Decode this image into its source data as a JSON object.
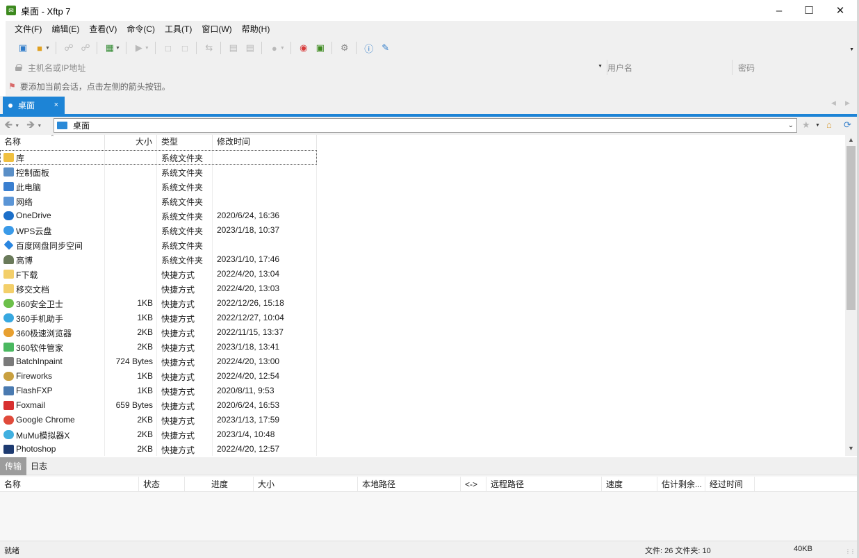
{
  "window": {
    "title": "桌面 - Xftp 7",
    "app_icon": "xftp-icon"
  },
  "menu": [
    "文件(F)",
    "编辑(E)",
    "查看(V)",
    "命令(C)",
    "工具(T)",
    "窗口(W)",
    "帮助(H)"
  ],
  "address": {
    "host_placeholder": "主机名或IP地址",
    "user_placeholder": "用户名",
    "password_placeholder": "密码"
  },
  "hint": "要添加当前会话，点击左侧的箭头按钮。",
  "tab": {
    "label": "桌面",
    "close": "×"
  },
  "path": "桌面",
  "columns": {
    "name": "名称",
    "size": "大小",
    "type": "类型",
    "modified": "修改时间"
  },
  "files": [
    {
      "name": "库",
      "size": "",
      "type": "系统文件夹",
      "modified": "",
      "icon": "library-icon"
    },
    {
      "name": "控制面板",
      "size": "",
      "type": "系统文件夹",
      "modified": "",
      "icon": "control-panel-icon"
    },
    {
      "name": "此电脑",
      "size": "",
      "type": "系统文件夹",
      "modified": "",
      "icon": "computer-icon"
    },
    {
      "name": "网络",
      "size": "",
      "type": "系统文件夹",
      "modified": "",
      "icon": "network-icon"
    },
    {
      "name": "OneDrive",
      "size": "",
      "type": "系统文件夹",
      "modified": "2020/6/24, 16:36",
      "icon": "onedrive-icon"
    },
    {
      "name": "WPS云盘",
      "size": "",
      "type": "系统文件夹",
      "modified": "2023/1/18, 10:37",
      "icon": "wps-cloud-icon"
    },
    {
      "name": "百度网盘同步空间",
      "size": "",
      "type": "系统文件夹",
      "modified": "",
      "icon": "baidu-netdisk-icon"
    },
    {
      "name": "高博",
      "size": "",
      "type": "系统文件夹",
      "modified": "2023/1/10, 17:46",
      "icon": "user-folder-icon"
    },
    {
      "name": "F下载",
      "size": "",
      "type": "快捷方式",
      "modified": "2022/4/20, 13:04",
      "icon": "folder-shortcut-icon"
    },
    {
      "name": "移交文档",
      "size": "",
      "type": "快捷方式",
      "modified": "2022/4/20, 13:03",
      "icon": "folder-shortcut-icon"
    },
    {
      "name": "360安全卫士",
      "size": "1KB",
      "type": "快捷方式",
      "modified": "2022/12/26, 15:18",
      "icon": "360-safe-icon"
    },
    {
      "name": "360手机助手",
      "size": "1KB",
      "type": "快捷方式",
      "modified": "2022/12/27, 10:04",
      "icon": "360-mobile-icon"
    },
    {
      "name": "360极速浏览器",
      "size": "2KB",
      "type": "快捷方式",
      "modified": "2022/11/15, 13:37",
      "icon": "360-browser-icon"
    },
    {
      "name": "360软件管家",
      "size": "2KB",
      "type": "快捷方式",
      "modified": "2023/1/18, 13:41",
      "icon": "360-software-icon"
    },
    {
      "name": "BatchInpaint",
      "size": "724 Bytes",
      "type": "快捷方式",
      "modified": "2022/4/20, 13:00",
      "icon": "batchinpaint-icon"
    },
    {
      "name": "Fireworks",
      "size": "1KB",
      "type": "快捷方式",
      "modified": "2022/4/20, 12:54",
      "icon": "fireworks-icon"
    },
    {
      "name": "FlashFXP",
      "size": "1KB",
      "type": "快捷方式",
      "modified": "2020/8/11, 9:53",
      "icon": "flashfxp-icon"
    },
    {
      "name": "Foxmail",
      "size": "659 Bytes",
      "type": "快捷方式",
      "modified": "2020/6/24, 16:53",
      "icon": "foxmail-icon"
    },
    {
      "name": "Google Chrome",
      "size": "2KB",
      "type": "快捷方式",
      "modified": "2023/1/13, 17:59",
      "icon": "chrome-icon"
    },
    {
      "name": "MuMu模拟器X",
      "size": "2KB",
      "type": "快捷方式",
      "modified": "2023/1/4, 10:48",
      "icon": "mumu-icon"
    },
    {
      "name": "Photoshop",
      "size": "2KB",
      "type": "快捷方式",
      "modified": "2022/4/20, 12:57",
      "icon": "photoshop-icon"
    }
  ],
  "transfer": {
    "tabs": [
      "传输",
      "日志"
    ],
    "columns": [
      "名称",
      "状态",
      "进度",
      "大小",
      "本地路径",
      "<->",
      "远程路径",
      "速度",
      "估计剩余...",
      "经过时间"
    ]
  },
  "status": {
    "ready": "就绪",
    "counts": "文件: 26  文件夹: 10",
    "size": "40KB"
  },
  "colors": {
    "accent": "#1d84d6",
    "selection_border": "#555555"
  }
}
